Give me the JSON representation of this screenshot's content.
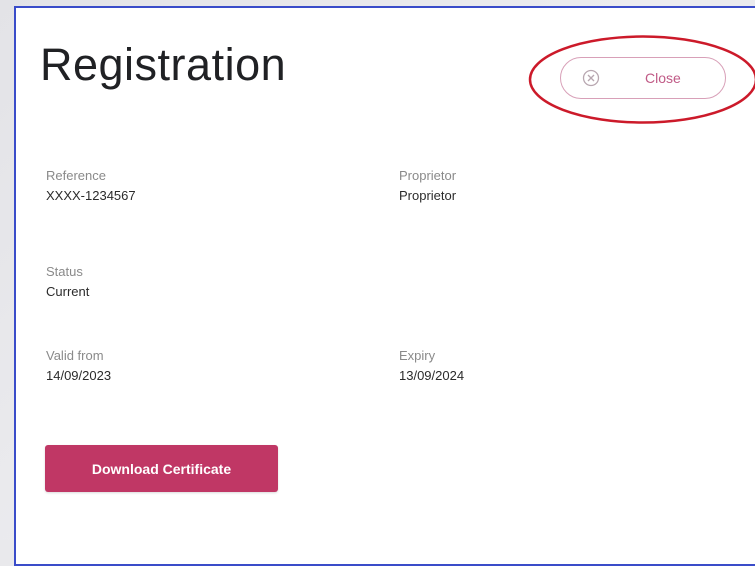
{
  "modal": {
    "title": "Registration",
    "close_label": "Close",
    "fields": {
      "reference": {
        "label": "Reference",
        "value": "XXXX-1234567"
      },
      "proprietor": {
        "label": "Proprietor",
        "value": "Proprietor"
      },
      "status": {
        "label": "Status",
        "value": "Current"
      },
      "valid_from": {
        "label": "Valid from",
        "value": "14/09/2023"
      },
      "expiry": {
        "label": "Expiry",
        "value": "13/09/2024"
      }
    },
    "download_label": "Download Certificate"
  },
  "colors": {
    "accent": "#c03765",
    "close_text": "#c05a86",
    "annotation": "#cc1a2a",
    "border": "#3a4cc9"
  },
  "icons": {
    "close": "close-circle-icon"
  }
}
